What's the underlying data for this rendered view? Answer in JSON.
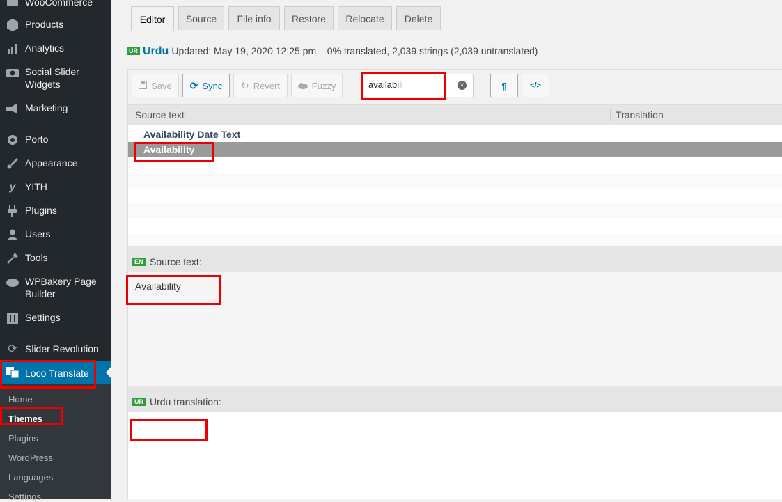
{
  "sidebar": {
    "items": [
      {
        "label": "WooCommerce",
        "icon": "woocommerce-icon"
      },
      {
        "label": "Products",
        "icon": "products-icon"
      },
      {
        "label": "Analytics",
        "icon": "analytics-icon"
      },
      {
        "label": "Social Slider Widgets",
        "icon": "camera-icon"
      },
      {
        "label": "Marketing",
        "icon": "megaphone-icon"
      },
      {
        "label": "Porto",
        "icon": "porto-icon"
      },
      {
        "label": "Appearance",
        "icon": "paintbrush-icon"
      },
      {
        "label": "YITH",
        "icon": "yith-icon"
      },
      {
        "label": "Plugins",
        "icon": "plugin-icon"
      },
      {
        "label": "Users",
        "icon": "user-icon"
      },
      {
        "label": "Tools",
        "icon": "wrench-icon"
      },
      {
        "label": "WPBakery Page Builder",
        "icon": "cloud-icon"
      },
      {
        "label": "Settings",
        "icon": "settings-icon"
      },
      {
        "label": "Slider Revolution",
        "icon": "refresh-icon"
      },
      {
        "label": "Loco Translate",
        "icon": "translate-icon"
      }
    ],
    "submenu": [
      "Home",
      "Themes",
      "Plugins",
      "WordPress",
      "Languages",
      "Settings"
    ]
  },
  "tabs": [
    "Editor",
    "Source",
    "File info",
    "Restore",
    "Relocate",
    "Delete"
  ],
  "status": {
    "flag": "UR",
    "language": "Urdu",
    "text": "Updated: May 19, 2020 12:25 pm – 0% translated, 2,039 strings (2,039 untranslated)"
  },
  "toolbar": {
    "save": "Save",
    "sync": "Sync",
    "revert": "Revert",
    "fuzzy": "Fuzzy",
    "search_value": "availabili",
    "pilcrow": "¶",
    "code": "</>"
  },
  "grid": {
    "col_source": "Source text",
    "col_translation": "Translation",
    "rows": [
      "Availability Date Text",
      "Availability"
    ]
  },
  "source_pane": {
    "flag": "EN",
    "label": "Source text:",
    "text": "Availability"
  },
  "translation_pane": {
    "flag": "UR",
    "label": "Urdu translation:"
  },
  "colors": {
    "sidebar_bg": "#23282d",
    "accent": "#0073aa",
    "flag_green": "#2e9d3a",
    "highlight_red": "#e00000"
  }
}
